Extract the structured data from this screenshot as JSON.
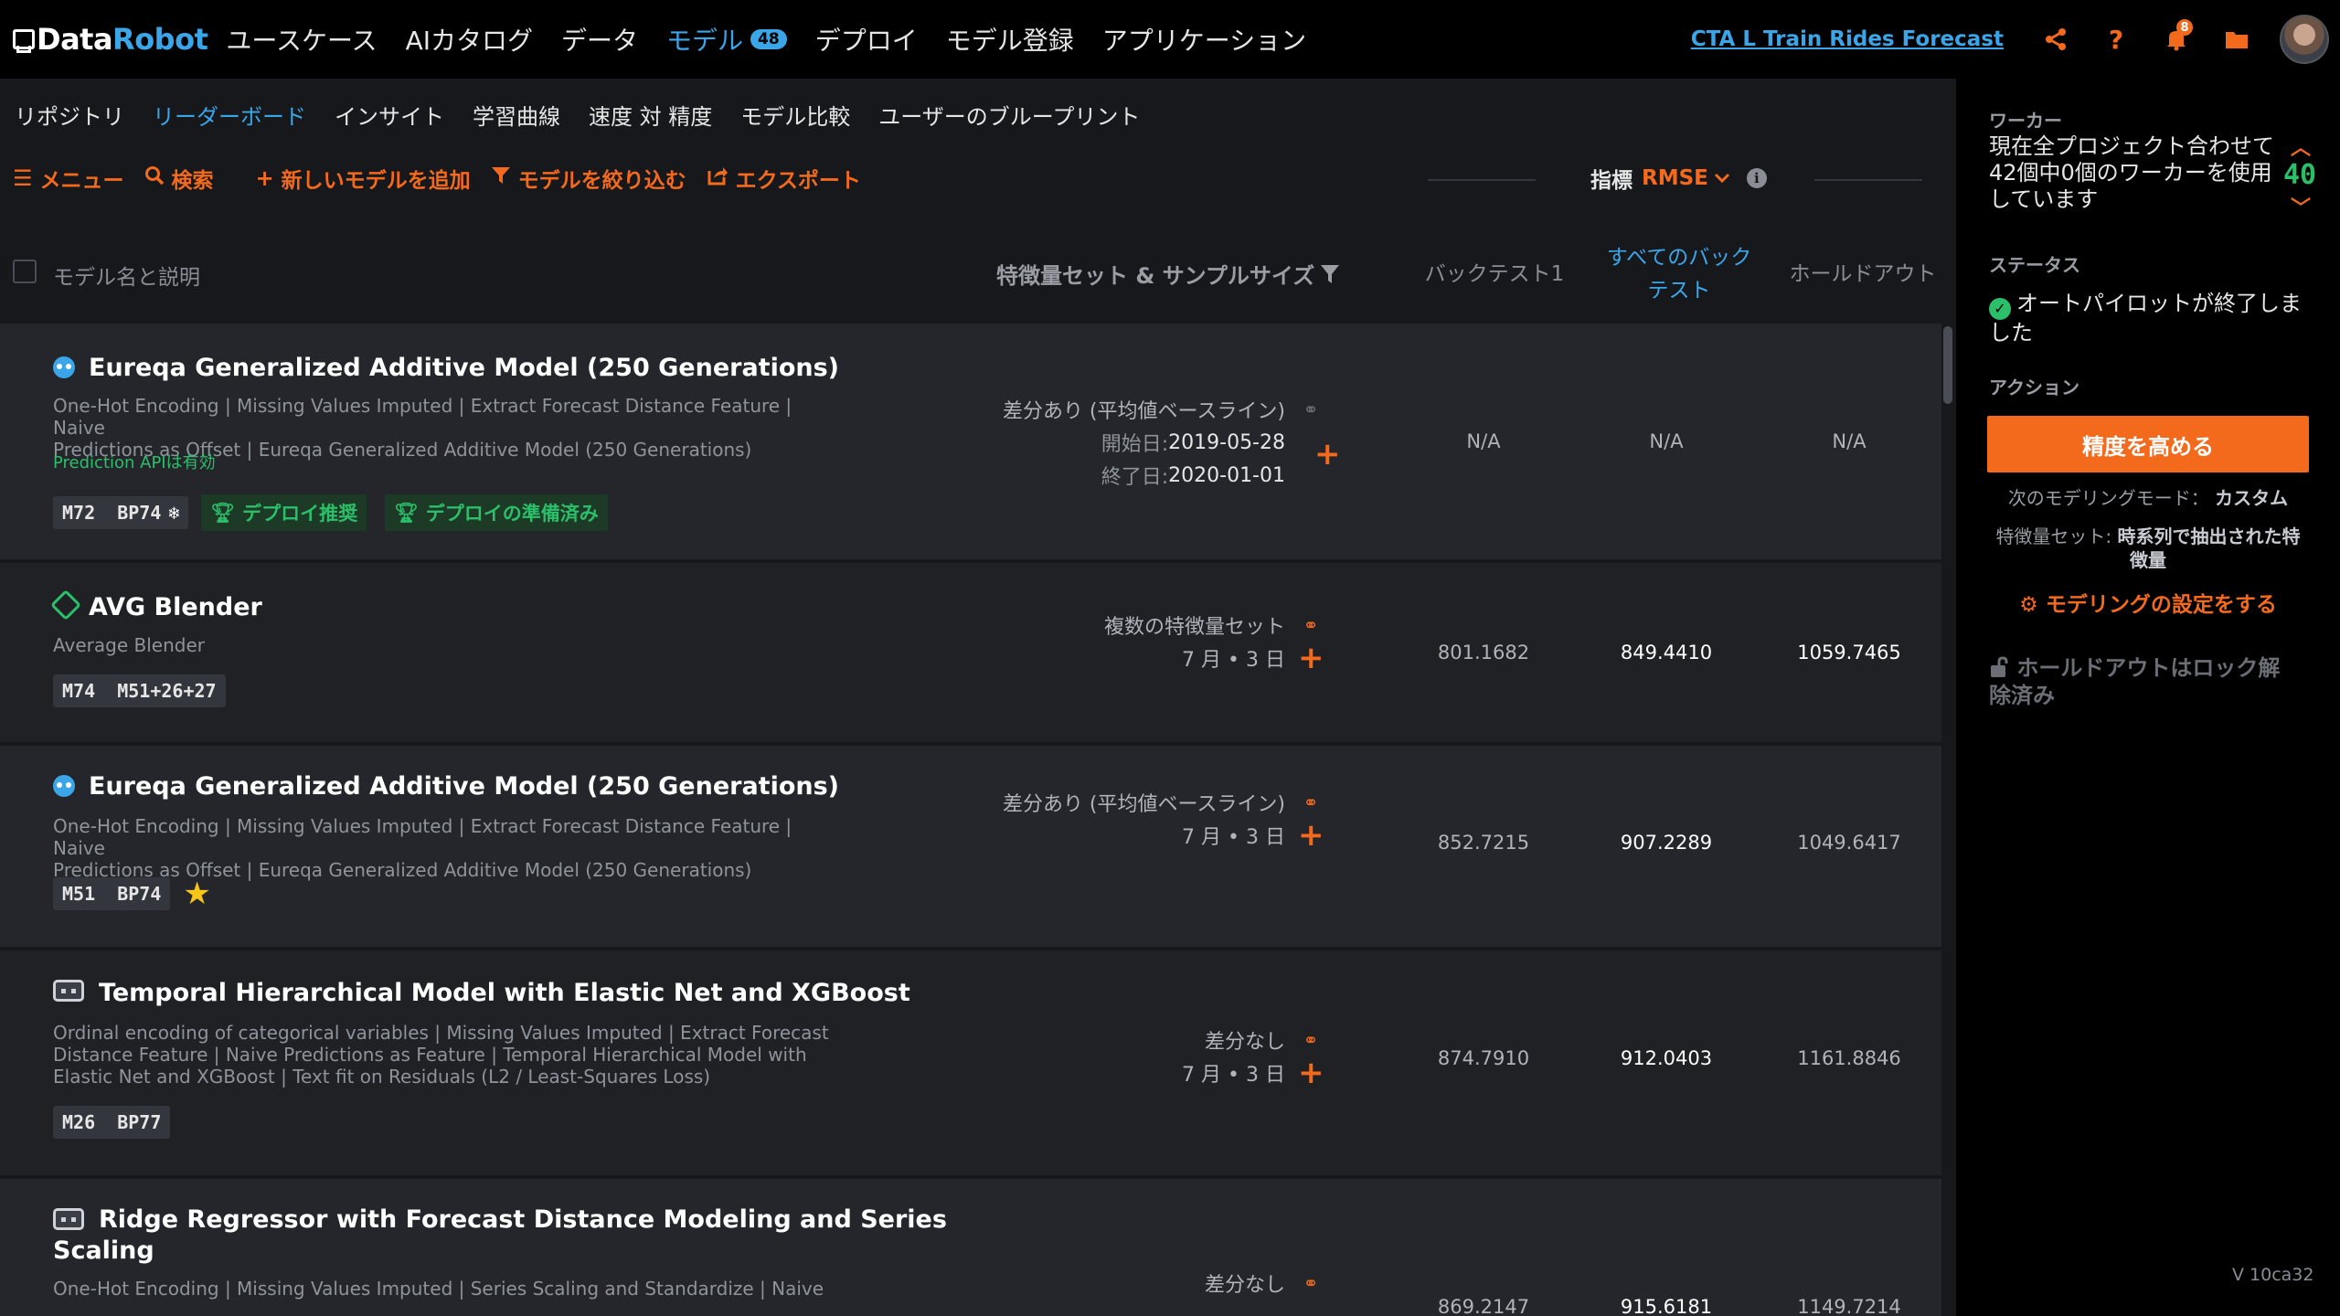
{
  "topbar": {
    "logo_data": "Data",
    "logo_robot": "Robot",
    "nav": [
      "ユースケース",
      "AIカタログ",
      "データ",
      "モデル",
      "デプロイ",
      "モデル登録",
      "アプリケーション"
    ],
    "models_badge": "48",
    "project_name": "CTA L Train Rides Forecast",
    "notification_count": "8",
    "icons": [
      "share-icon",
      "help-icon",
      "bell-icon",
      "folder-icon",
      "user-avatar"
    ]
  },
  "subnav": [
    "リポジトリ",
    "リーダーボード",
    "インサイト",
    "学習曲線",
    "速度 対 精度",
    "モデル比較",
    "ユーザーのブループリント"
  ],
  "toolbar": {
    "menu": "メニュー",
    "search": "検索",
    "add_model": "新しいモデルを追加",
    "filter_models": "モデルを絞り込む",
    "export": "エクスポート",
    "metric_label": "指標",
    "metric_value": "RMSE"
  },
  "table_header": {
    "name": "モデル名と説明",
    "feature": "特徴量セット & サンプルサイズ",
    "backtest1": "バックテスト1",
    "all_backtests_1": "すべてのバック",
    "all_backtests_2": "テスト",
    "holdout": "ホールドアウト"
  },
  "rows": [
    {
      "title": "Eureqa Generalized Additive Model (250 Generations)",
      "desc1": "One-Hot Encoding | Missing Values Imputed | Extract Forecast Distance Feature | Naive",
      "desc2": "Predictions as Offset | Eureqa Generalized Additive Model (250 Generations)",
      "api": "Prediction APIは有効",
      "tag": "M72  BP74",
      "badge1": "デプロイ推奨",
      "badge2": "デプロイの準備済み",
      "feature": "差分あり (平均値ベースライン)",
      "start_label": "開始日:",
      "start_value": "2019-05-28",
      "end_label": "終了日:",
      "end_value": "2020-01-01",
      "backtest1": "N/A",
      "all_backtests": "N/A",
      "holdout": "N/A"
    },
    {
      "title": "AVG Blender",
      "desc1": "Average Blender",
      "tag": "M74  M51+26+27",
      "feature": "複数の特徴量セット",
      "sample": "7 月 • 3 日",
      "backtest1": "801.1682",
      "all_backtests": "849.4410",
      "holdout": "1059.7465"
    },
    {
      "title": "Eureqa Generalized Additive Model (250 Generations)",
      "desc1": "One-Hot Encoding | Missing Values Imputed | Extract Forecast Distance Feature | Naive",
      "desc2": "Predictions as Offset | Eureqa Generalized Additive Model (250 Generations)",
      "tag": "M51  BP74",
      "feature": "差分あり (平均値ベースライン)",
      "sample": "7 月 • 3 日",
      "backtest1": "852.7215",
      "all_backtests": "907.2289",
      "holdout": "1049.6417"
    },
    {
      "title": "Temporal Hierarchical Model with Elastic Net and XGBoost",
      "desc1": "Ordinal encoding of categorical variables | Missing Values Imputed | Extract Forecast",
      "desc2": "Distance Feature | Naive Predictions as Feature | Temporal Hierarchical Model with",
      "desc3": "Elastic Net and XGBoost | Text fit on Residuals (L2 / Least-Squares Loss)",
      "tag": "M26  BP77",
      "feature": "差分なし",
      "sample": "7 月 • 3 日",
      "backtest1": "874.7910",
      "all_backtests": "912.0403",
      "holdout": "1161.8846"
    },
    {
      "title1": "Ridge Regressor with Forecast Distance Modeling and Series",
      "title2": "Scaling",
      "desc1": "One-Hot Encoding | Missing Values Imputed | Series Scaling and Standardize | Naive",
      "feature": "差分なし",
      "backtest1": "869.2147",
      "all_backtests": "915.6181",
      "holdout": "1149.7214"
    }
  ],
  "right_panel": {
    "workers_head": "ワーカー",
    "workers_text1": "現在全プロジェクト合わせて",
    "workers_text2": "42個中0個のワーカーを使用",
    "workers_text3": "しています",
    "workers_count": "40",
    "status_head": "ステータス",
    "status_text1": "オートパイロットが終了しま",
    "status_text2": "した",
    "action_head": "アクション",
    "improve_button": "精度を高める",
    "next_mode_label": "次のモデリングモード：",
    "next_mode_value": "カスタム",
    "feature_set_label": "特徴量セット:",
    "feature_set_value1": "時系列で抽出された特",
    "feature_set_value2": "徴量",
    "config_link": "モデリングの設定をする",
    "holdout_text1": "ホールドアウトはロック解",
    "holdout_text2": "除済み",
    "version": "V 10ca32"
  },
  "colors": {
    "accent_orange": "#f36a1d",
    "accent_blue": "#3aa6e8",
    "success_green": "#2bbf6a"
  }
}
